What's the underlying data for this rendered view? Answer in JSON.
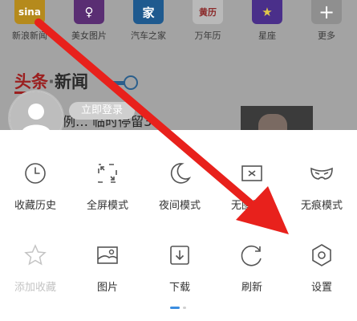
{
  "apps": [
    {
      "label": "新浪新闻",
      "icon_text": "sina",
      "color": "#b58a1c",
      "icon": "sina-news-icon"
    },
    {
      "label": "美女图片",
      "icon_text": "♀",
      "color": "#5a2e73",
      "icon": "beauty-pics-icon"
    },
    {
      "label": "汽车之家",
      "icon_text": "家",
      "color": "#1f5a8f",
      "icon": "autohome-icon"
    },
    {
      "label": "万年历",
      "icon_text": "黄历",
      "color": "#b9b9b9",
      "icon": "calendar-icon"
    },
    {
      "label": "星座",
      "icon_text": "★",
      "color": "#4a2f8a",
      "icon": "horoscope-icon"
    },
    {
      "label": "更多",
      "icon_text": "+",
      "color": "#8f8f8f",
      "icon": "more-icon"
    }
  ],
  "news": {
    "tab_a": "头条",
    "tab_sep": "·",
    "tab_b": "新闻",
    "login": "立即登录",
    "headline": "例…  临时停留3"
  },
  "menu": {
    "row1": [
      {
        "label": "收藏历史",
        "icon": "clock-icon"
      },
      {
        "label": "全屏模式",
        "icon": "fullscreen-icon"
      },
      {
        "label": "夜间模式",
        "icon": "moon-icon"
      },
      {
        "label": "无图模式",
        "icon": "no-image-icon"
      },
      {
        "label": "无痕模式",
        "icon": "mask-icon"
      }
    ],
    "row2": [
      {
        "label": "添加收藏",
        "icon": "star-icon",
        "disabled": true
      },
      {
        "label": "图片",
        "icon": "picture-icon"
      },
      {
        "label": "下载",
        "icon": "download-icon"
      },
      {
        "label": "刷新",
        "icon": "refresh-icon"
      },
      {
        "label": "设置",
        "icon": "settings-hexagon-icon"
      }
    ]
  },
  "colors": {
    "arrow": "#e8211c",
    "accent": "#3b8de0",
    "news_red": "#9b1f1f"
  }
}
